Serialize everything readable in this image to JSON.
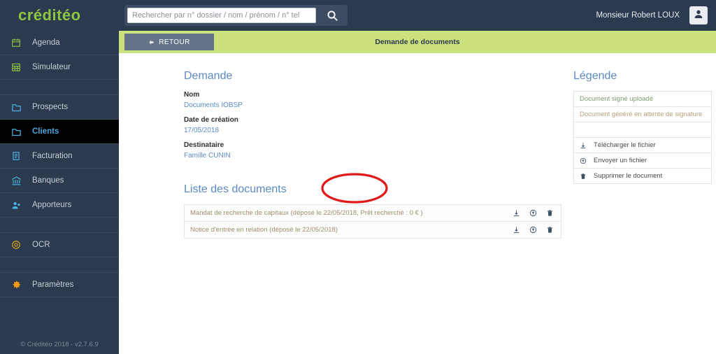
{
  "header": {
    "logo_text": "créditéo",
    "search": {
      "placeholder": "Rechercher par n° dossier / nom / prénom / n° tel",
      "value": "",
      "button_icon": "search-icon"
    },
    "user_name": "Monsieur Robert LOUX",
    "avatar_icon": "user-icon"
  },
  "sidebar": {
    "items": [
      {
        "label": "Agenda",
        "icon": "calendar-icon",
        "active": false
      },
      {
        "label": "Simulateur",
        "icon": "grid-icon",
        "active": false
      },
      {
        "label": "",
        "icon": "",
        "active": false,
        "spacer": true
      },
      {
        "label": "Prospects",
        "icon": "folder-icon",
        "active": false
      },
      {
        "label": "Clients",
        "icon": "folder-icon",
        "active": true
      },
      {
        "label": "Facturation",
        "icon": "invoice-icon",
        "active": false
      },
      {
        "label": "Banques",
        "icon": "bank-icon",
        "active": false
      },
      {
        "label": "Apporteurs",
        "icon": "handshake-icon",
        "active": false
      },
      {
        "label": "",
        "icon": "",
        "active": false,
        "spacer": true
      },
      {
        "label": "OCR",
        "icon": "ocr-icon",
        "active": false
      },
      {
        "label": "",
        "icon": "",
        "active": false,
        "spacer": true
      },
      {
        "label": "Paramètres",
        "icon": "gear-icon",
        "active": false
      }
    ],
    "footer": "© Créditéo 2018 - v2.7.6.9"
  },
  "subbar": {
    "back_label": "RETOUR",
    "back_icon": "arrow-left-icon",
    "title": "Demande de documents"
  },
  "demande": {
    "heading": "Demande",
    "fields": [
      {
        "label": "Nom",
        "value": "Documents IOBSP"
      },
      {
        "label": "Date de création",
        "value": "17/05/2018"
      },
      {
        "label": "Destinataire",
        "value": "Famille CUNIN"
      }
    ]
  },
  "documents": {
    "heading": "Liste des documents",
    "rows": [
      {
        "text": "Mandat de recherche de capitaux (déposé le 22/05/2018, Prêt recherché : 0 € )"
      },
      {
        "text": "Notice d'entrée en relation (déposé le 22/05/2018)"
      }
    ],
    "actions": [
      {
        "icon": "download-icon",
        "title": "Télécharger le fichier"
      },
      {
        "icon": "upload-icon",
        "title": "Envoyer un fichier"
      },
      {
        "icon": "trash-icon",
        "title": "Supprimer le document"
      }
    ]
  },
  "legende": {
    "heading": "Légende",
    "rows": [
      {
        "label": "Document signé uploadé",
        "icon": "",
        "style": "green"
      },
      {
        "label": "Document généré en attente de signature",
        "icon": "",
        "style": "tan"
      },
      {
        "label": "",
        "icon": "",
        "style": "empty"
      },
      {
        "label": "Télécharger le fichier",
        "icon": "download-icon",
        "style": "dark"
      },
      {
        "label": "Envoyer un fichier",
        "icon": "upload-icon",
        "style": "dark"
      },
      {
        "label": "Supprimer le document",
        "icon": "trash-icon",
        "style": "dark"
      }
    ]
  },
  "annotation": {
    "shape": "red-ellipse",
    "color": "#e01b1b",
    "targets": "Prêt recherché : 0 €"
  },
  "colors": {
    "brand_green": "#8dc63f",
    "subbar_green": "#cbe27c",
    "navy": "#2b3a4f",
    "link_blue": "#5b8ac4",
    "annotation_red": "#e01b1b"
  }
}
